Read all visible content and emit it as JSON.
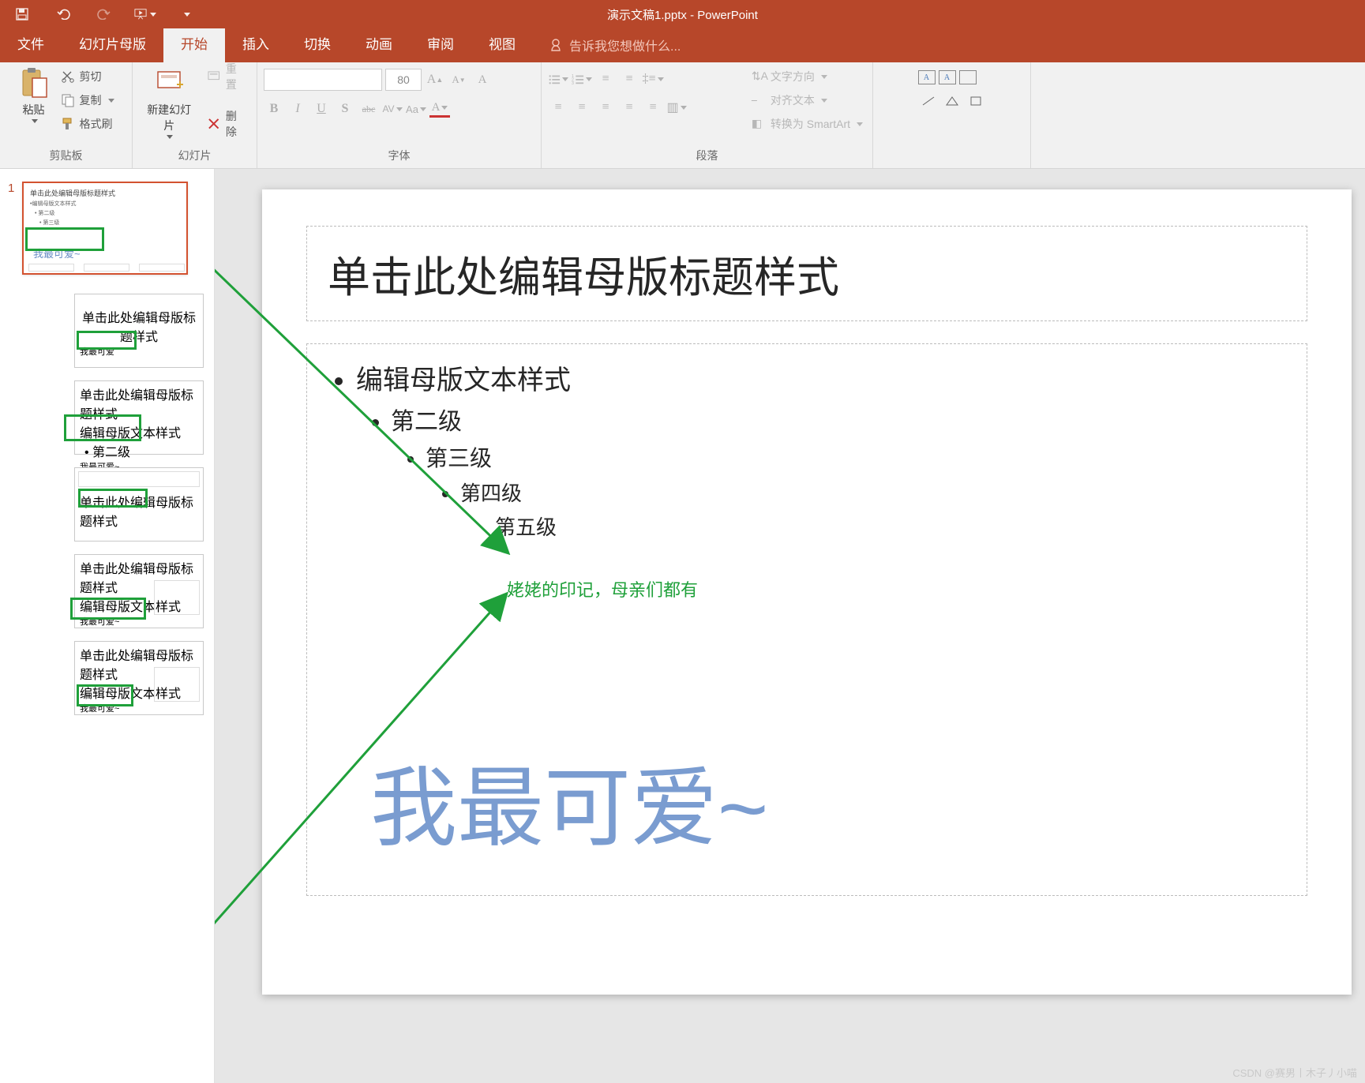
{
  "app": {
    "title": "演示文稿1.pptx - PowerPoint"
  },
  "tabs": {
    "file": "文件",
    "master": "幻灯片母版",
    "home": "开始",
    "insert": "插入",
    "transition": "切换",
    "animation": "动画",
    "review": "审阅",
    "view": "视图",
    "tellme": "告诉我您想做什么..."
  },
  "ribbon": {
    "clipboard": {
      "paste": "粘贴",
      "cut": "剪切",
      "copy": "复制",
      "formatPainter": "格式刷",
      "group": "剪贴板"
    },
    "slides": {
      "new": "新建幻灯片",
      "reset": "重置",
      "delete": "删除",
      "group": "幻灯片"
    },
    "font": {
      "size": "80",
      "group": "字体",
      "bold": "B",
      "italic": "I",
      "underline": "U",
      "shadow": "S",
      "strike": "abc",
      "spacing": "AV",
      "case": "Aa",
      "clear": "A"
    },
    "paragraph": {
      "textDir": "文字方向",
      "align": "对齐文本",
      "smartart": "转换为 SmartArt",
      "group": "段落"
    }
  },
  "thumbnails": {
    "num1": "1",
    "t1_title": "单击此处编辑母版标题样式",
    "t1_body": "•编辑母版文本样式",
    "t1_l2": "• 第二级",
    "t1_l3": "• 第三级",
    "t1_big": "我最可爱~",
    "t2_title": "单击此处编辑母版标题样式",
    "t2_big": "我最可爱",
    "t3_title": "单击此处编辑母版标题样式",
    "t3_body": "编辑母版文本样式",
    "t3_l2": "• 第二级",
    "t3_big": "我最可爱~",
    "t4_title": "单击此处编辑母版标题样式",
    "t5_title": "单击此处编辑母版标题样式",
    "t5_body": "编辑母版文本样式",
    "t5_big": "我最可爱~",
    "t6_title": "单击此处编辑母版标题样式",
    "t6_body": "编辑母版文本样式",
    "t6_big": "我最可爱~"
  },
  "slide": {
    "title": "单击此处编辑母版标题样式",
    "l1": "编辑母版文本样式",
    "l2": "第二级",
    "l3": "第三级",
    "l4": "第四级",
    "l5": "第五级",
    "big": "我最可爱~"
  },
  "annotation": "姥姥的印记，母亲们都有",
  "watermark": "CSDN @赛男丨木子丿小喵"
}
